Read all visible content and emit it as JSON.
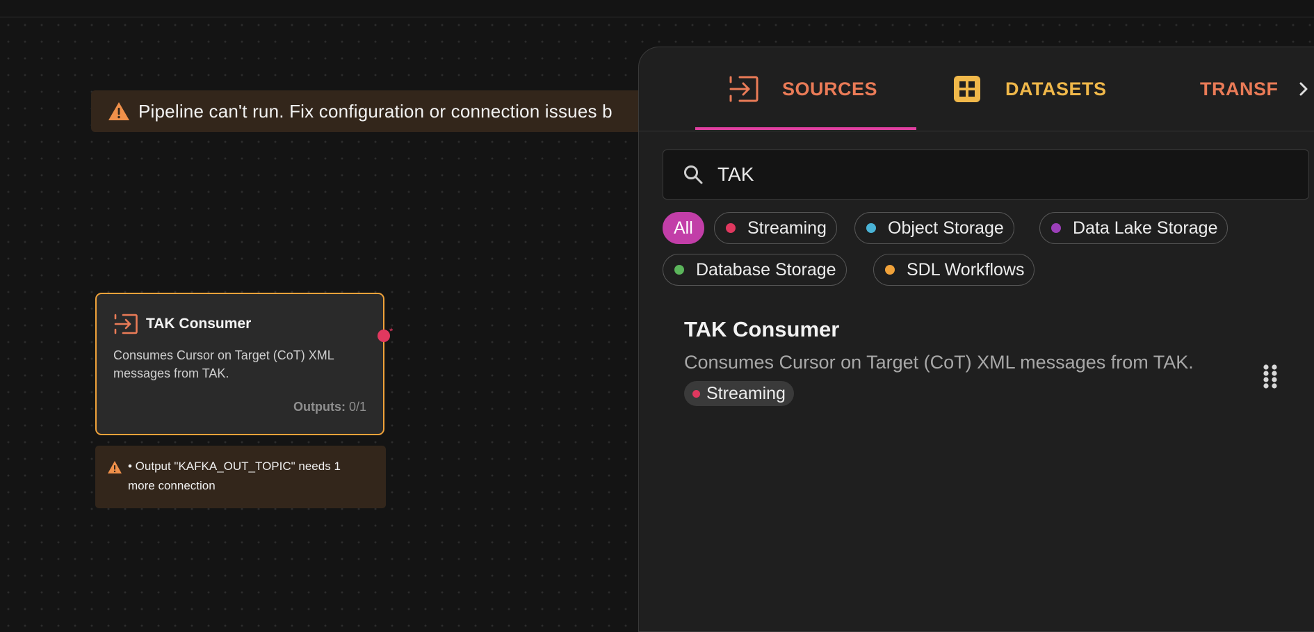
{
  "banner": {
    "text": "Pipeline can't run. Fix configuration or connection issues b",
    "icon": "warning-icon"
  },
  "node": {
    "title": "TAK Consumer",
    "description": "Consumes Cursor on Target (CoT) XML messages from TAK.",
    "outputs_label": "Outputs:",
    "outputs_value": "0/1",
    "port_marker": "*",
    "border_color": "#f0a23a",
    "warning": "• Output \"KAFKA_OUT_TOPIC\" needs 1 more connection"
  },
  "panel": {
    "tabs": [
      {
        "label": "SOURCES",
        "icon": "source-input-icon",
        "color": "#ea7b57",
        "active": true
      },
      {
        "label": "DATASETS",
        "icon": "grid-icon",
        "color": "#f0b84a"
      },
      {
        "label": "TRANSFORMS",
        "icon": "crop-icon",
        "color": "#ea7b57"
      }
    ],
    "search": {
      "value": "TAK",
      "icon": "search-icon"
    },
    "filters": [
      {
        "label": "All",
        "selected": true,
        "color": "#c23ea8"
      },
      {
        "label": "Streaming",
        "color": "#e0385f"
      },
      {
        "label": "Object Storage",
        "color": "#4ab3d6"
      },
      {
        "label": "Data Lake Storage",
        "color": "#9b3fb8"
      },
      {
        "label": "Database Storage",
        "color": "#5bb55b"
      },
      {
        "label": "SDL Workflows",
        "color": "#f0a23a"
      }
    ],
    "results": [
      {
        "title": "TAK Consumer",
        "description": "Consumes Cursor on Target (CoT) XML messages from TAK.",
        "tag": "Streaming",
        "tag_color": "#e0385f"
      }
    ]
  }
}
